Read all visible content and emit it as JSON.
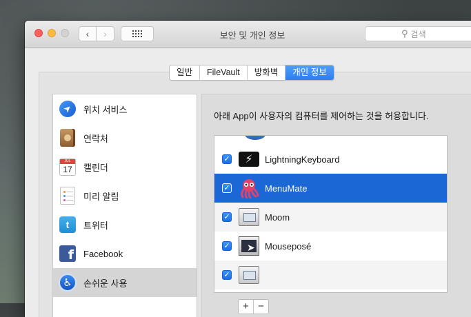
{
  "window": {
    "title": "보안 및 개인 정보"
  },
  "toolbar": {
    "search_placeholder": "검색",
    "back": "‹",
    "forward": "›"
  },
  "tabs": [
    {
      "label": "일반",
      "active": false
    },
    {
      "label": "FileVault",
      "active": false
    },
    {
      "label": "방화벽",
      "active": false
    },
    {
      "label": "개인 정보",
      "active": true
    }
  ],
  "sidebar": {
    "items": [
      {
        "label": "위치 서비스",
        "icon": "location-arrow-icon"
      },
      {
        "label": "연락처",
        "icon": "contacts-book-icon"
      },
      {
        "label": "캘린더",
        "icon": "calendar-icon",
        "month": "JUL",
        "day": "17"
      },
      {
        "label": "미리 알림",
        "icon": "reminders-icon"
      },
      {
        "label": "트위터",
        "icon": "twitter-icon"
      },
      {
        "label": "Facebook",
        "icon": "facebook-icon"
      },
      {
        "label": "손쉬운 사용",
        "icon": "accessibility-icon",
        "selected": true
      }
    ]
  },
  "main": {
    "description": "아래 App이 사용자의 컴퓨터를 제어하는 것을 허용합니다.",
    "apps": [
      {
        "name": "LightningKeyboard",
        "checked": true,
        "icon": "lightning-keyboard-icon"
      },
      {
        "name": "MenuMate",
        "checked": true,
        "selected": true,
        "icon": "menumate-octopus-icon"
      },
      {
        "name": "Moom",
        "checked": true,
        "icon": "moom-window-icon"
      },
      {
        "name": "Mouseposé",
        "checked": true,
        "icon": "mousepose-icon"
      }
    ],
    "add_label": "+",
    "remove_label": "−"
  },
  "colors": {
    "accent": "#1b67d5",
    "close": "#fc615d",
    "minimize": "#fdbc40"
  }
}
